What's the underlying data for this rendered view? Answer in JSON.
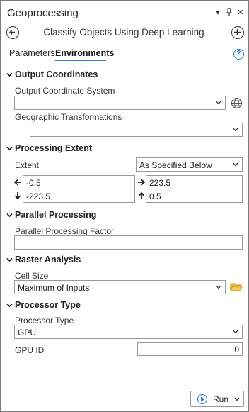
{
  "titlebar": {
    "title": "Geoprocessing",
    "menu_glyph": "▾",
    "pin_glyph": "⊣",
    "close_glyph": "✕"
  },
  "tool": {
    "title": "Classify Objects Using Deep Learning"
  },
  "tabs": [
    {
      "label": "Parameters",
      "active": false
    },
    {
      "label": "Environments",
      "active": true
    }
  ],
  "help_glyph": "?",
  "sections": {
    "output_coordinates": {
      "label": "Output Coordinates",
      "output_coordinate_system_label": "Output Coordinate System",
      "output_coordinate_system_value": "",
      "geographic_transformations_label": "Geographic Transformations",
      "geographic_transformations_value": ""
    },
    "processing_extent": {
      "label": "Processing Extent",
      "extent_label": "Extent",
      "extent_value": "As Specified Below",
      "left": "-0.5",
      "right": "223.5",
      "bottom": "-223.5",
      "top": "0.5"
    },
    "parallel_processing": {
      "label": "Parallel Processing",
      "factor_label": "Parallel Processing Factor",
      "factor_value": ""
    },
    "raster_analysis": {
      "label": "Raster Analysis",
      "cell_size_label": "Cell Size",
      "cell_size_value": "Maximum of Inputs"
    },
    "processor_type": {
      "label": "Processor Type",
      "processor_type_label": "Processor Type",
      "processor_type_value": "GPU",
      "gpu_id_label": "GPU ID",
      "gpu_id_value": "0"
    }
  },
  "run_button": {
    "label": "Run"
  },
  "colors": {
    "accent": "#2b7cd3",
    "folder": "#e8a317"
  }
}
